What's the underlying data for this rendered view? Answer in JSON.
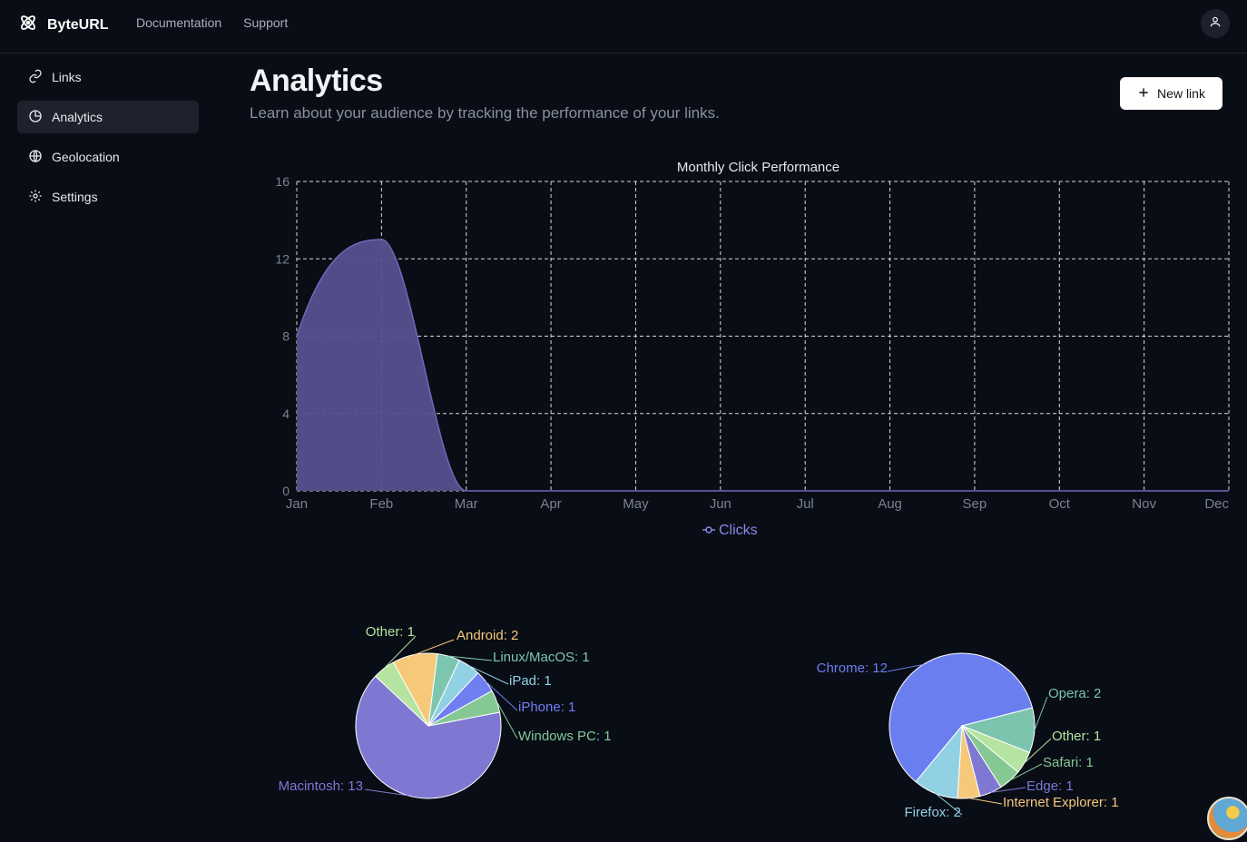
{
  "brand": {
    "name": "ByteURL"
  },
  "topnav": {
    "documentation": "Documentation",
    "support": "Support"
  },
  "sidebar": {
    "items": [
      {
        "label": "Links",
        "icon": "link-icon"
      },
      {
        "label": "Analytics",
        "icon": "pie-icon",
        "active": true
      },
      {
        "label": "Geolocation",
        "icon": "globe-icon"
      },
      {
        "label": "Settings",
        "icon": "gear-icon"
      }
    ]
  },
  "page": {
    "title": "Analytics",
    "subtitle": "Learn about your audience by tracking the performance of your links.",
    "new_link_label": "New link"
  },
  "colors": {
    "background": "#090d16",
    "area": "#56508f",
    "area_line": "#6e6ab8",
    "series_label": "#8e88e6"
  },
  "chart_data": [
    {
      "type": "area",
      "title": "Monthly Click Performance",
      "categories": [
        "Jan",
        "Feb",
        "Mar",
        "Apr",
        "May",
        "Jun",
        "Jul",
        "Aug",
        "Sep",
        "Oct",
        "Nov",
        "Dec"
      ],
      "series": [
        {
          "name": "Clicks",
          "values": [
            8,
            13,
            0,
            0,
            0,
            0,
            0,
            0,
            0,
            0,
            0,
            0
          ]
        }
      ],
      "yticks": [
        0,
        4,
        8,
        12,
        16
      ],
      "ylim": [
        0,
        16
      ],
      "grid": true,
      "legend": "bottom"
    },
    {
      "type": "pie",
      "slices": [
        {
          "label": "Macintosh: 13",
          "value": 13,
          "color": "#7f78d2"
        },
        {
          "label": "Other: 1",
          "value": 1,
          "color": "#b5e3a0"
        },
        {
          "label": "Android: 2",
          "value": 2,
          "color": "#f6c87a"
        },
        {
          "label": "Linux/MacOS: 1",
          "value": 1,
          "color": "#7cc6b0"
        },
        {
          "label": "iPad: 1",
          "value": 1,
          "color": "#92d1e4"
        },
        {
          "label": "iPhone: 1",
          "value": 1,
          "color": "#6f7ef0"
        },
        {
          "label": "Windows PC: 1",
          "value": 1,
          "color": "#86c894"
        }
      ]
    },
    {
      "type": "pie",
      "slices": [
        {
          "label": "Chrome: 12",
          "value": 12,
          "color": "#6b7ef0"
        },
        {
          "label": "Opera: 2",
          "value": 2,
          "color": "#7dc4ae"
        },
        {
          "label": "Other: 1",
          "value": 1,
          "color": "#b5e3a0"
        },
        {
          "label": "Safari: 1",
          "value": 1,
          "color": "#86c894"
        },
        {
          "label": "Edge: 1",
          "value": 1,
          "color": "#7f78d2"
        },
        {
          "label": "Internet Explorer: 1",
          "value": 1,
          "color": "#f6c87a"
        },
        {
          "label": "Firefox: 2",
          "value": 2,
          "color": "#92d1e4"
        }
      ]
    }
  ]
}
